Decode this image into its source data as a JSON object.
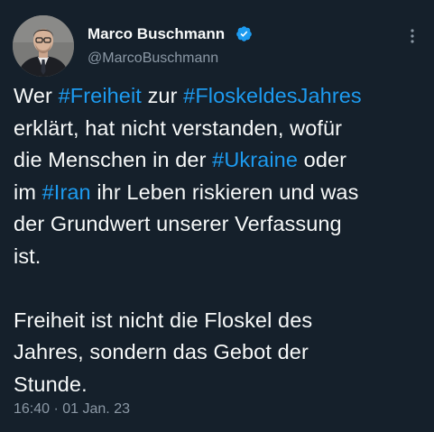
{
  "colors": {
    "background": "#15202b",
    "text": "#f7f9f9",
    "secondary_text": "#8b98a5",
    "hashtag": "#1d9bf0",
    "verified_badge": "#1d9bf0"
  },
  "author": {
    "display_name": "Marco Buschmann",
    "handle": "@MarcoBuschmann",
    "verified_icon": "verified-badge-icon",
    "avatar_icon": "profile-photo"
  },
  "menu": {
    "icon": "more-options-vertical-icon"
  },
  "tweet": {
    "lines": [
      [
        {
          "t": "Wer "
        },
        {
          "t": "#Freiheit",
          "tag": true
        },
        {
          "t": " zur "
        },
        {
          "t": "#FloskeldesJahres",
          "tag": true
        }
      ],
      [
        {
          "t": "erklärt, hat nicht verstanden, wofür"
        }
      ],
      [
        {
          "t": "die Menschen in der "
        },
        {
          "t": "#Ukraine",
          "tag": true
        },
        {
          "t": " oder"
        }
      ],
      [
        {
          "t": "im "
        },
        {
          "t": "#Iran",
          "tag": true
        },
        {
          "t": " ihr Leben riskieren und was"
        }
      ],
      [
        {
          "t": "der Grundwert unserer Verfassung"
        }
      ],
      [
        {
          "t": "ist."
        }
      ],
      [],
      [
        {
          "t": "Freiheit ist nicht die Floskel des"
        }
      ],
      [
        {
          "t": "Jahres, sondern das Gebot der"
        }
      ],
      [
        {
          "t": "Stunde."
        }
      ]
    ],
    "timestamp": "16:40 · 01 Jan. 23"
  }
}
